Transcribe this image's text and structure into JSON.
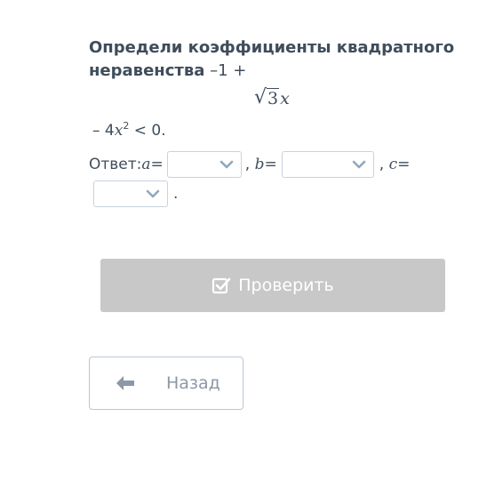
{
  "question": {
    "title_bold": "Определи коэффициенты квадратного неравенства",
    "title_tail": " –1 +",
    "sqrt_radicand": "3",
    "sqrt_var": "x",
    "line2_prefix": "– 4",
    "line2_var": "x",
    "line2_exp": "2",
    "line2_suffix": " < 0."
  },
  "answer": {
    "label": "Ответ: ",
    "a_var": "a",
    "b_var": "b",
    "c_var": "c",
    "equals": " =",
    "comma": ",",
    "period": "."
  },
  "dropdowns": {
    "a_value": "",
    "b_value": "",
    "c_value": ""
  },
  "buttons": {
    "check_label": "Проверить",
    "back_label": "Назад"
  },
  "colors": {
    "check_bg": "#c8c8c8",
    "dropdown_border": "#c6d3de",
    "chevron": "#8fa8bd",
    "back_border": "#b9c7d3"
  },
  "icons": {
    "check": "checkbox-check-icon",
    "dropdown": "chevron-down-icon",
    "back": "arrow-left-icon"
  }
}
